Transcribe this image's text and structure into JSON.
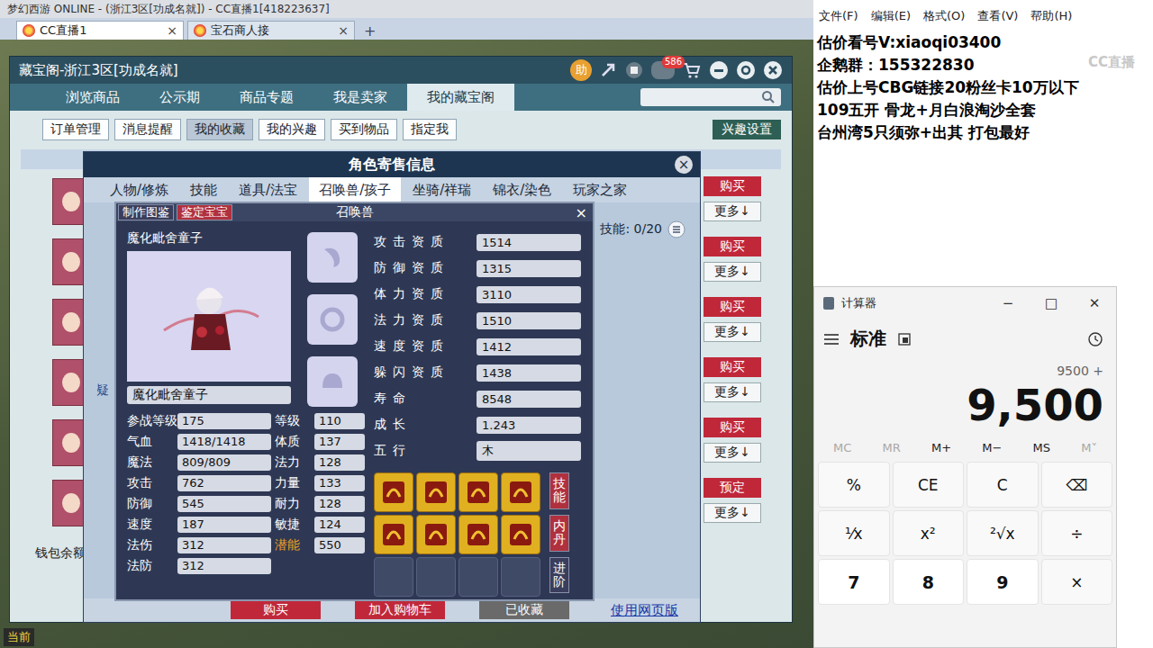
{
  "browser": {
    "title": "梦幻西游 ONLINE - (浙江3区[功成名就]) - CC直播1[418223637]",
    "tabs": [
      {
        "label": "CC直播1",
        "selected": true,
        "close": "×"
      },
      {
        "label": "宝石商人接",
        "selected": false,
        "close": "×"
      }
    ],
    "new_tab": "+"
  },
  "game": {
    "status": "当前"
  },
  "cbg": {
    "title": "藏宝阁-浙江3区[功成名就]",
    "help": "助",
    "badge": "586",
    "nav": [
      {
        "label": "浏览商品",
        "selected": false
      },
      {
        "label": "公示期",
        "selected": false
      },
      {
        "label": "商品专题",
        "selected": false
      },
      {
        "label": "我是卖家",
        "selected": false
      },
      {
        "label": "我的藏宝阁",
        "selected": true
      }
    ],
    "sub_tabs": [
      {
        "label": "订单管理",
        "selected": false
      },
      {
        "label": "消息提醒",
        "selected": false
      },
      {
        "label": "我的收藏",
        "selected": true
      },
      {
        "label": "我的兴趣",
        "selected": false
      },
      {
        "label": "买到物品",
        "selected": false
      },
      {
        "label": "指定我",
        "selected": false
      }
    ],
    "interest": "兴趣设置",
    "rows": [
      {
        "action": "购买",
        "more": "更多↓"
      },
      {
        "action": "购买",
        "more": "更多↓"
      },
      {
        "action": "购买",
        "more": "更多↓"
      },
      {
        "action": "购买",
        "more": "更多↓"
      },
      {
        "action": "购买",
        "more": "更多↓"
      },
      {
        "action": "预定",
        "more": "更多↓"
      }
    ],
    "wallet": "钱包余额"
  },
  "dialog": {
    "title": "角色寄售信息",
    "close": "×",
    "skills_count": "技能: 0/20",
    "hint": "疑",
    "tabs": [
      {
        "label": "人物/修炼",
        "selected": false
      },
      {
        "label": "技能",
        "selected": false
      },
      {
        "label": "道具/法宝",
        "selected": false
      },
      {
        "label": "召唤兽/孩子",
        "selected": true
      },
      {
        "label": "坐骑/祥瑞",
        "selected": false
      },
      {
        "label": "锦衣/染色",
        "selected": false
      },
      {
        "label": "玩家之家",
        "selected": false
      }
    ],
    "footer": [
      "购买",
      "加入购物车",
      "已收藏"
    ],
    "web_link": "使用网页版"
  },
  "pet": {
    "title": "召唤兽",
    "close": "×",
    "buttons": [
      {
        "label": "制作图鉴",
        "color": "#3a3d5c"
      },
      {
        "label": "鉴定宝宝",
        "color": "#b0303e"
      }
    ],
    "name": "魔化毗舍童子",
    "name_field": "魔化毗舍童子",
    "aptitudes": [
      {
        "label": "攻击资质",
        "value": "1514",
        "highlight": false
      },
      {
        "label": "防御资质",
        "value": "1315",
        "highlight": false
      },
      {
        "label": "体力资质",
        "value": "3110",
        "highlight": false
      },
      {
        "label": "法力资质",
        "value": "1510",
        "highlight": false
      },
      {
        "label": "速度资质",
        "value": "1412",
        "highlight": false
      },
      {
        "label": "躲闪资质",
        "value": "1438",
        "highlight": false
      },
      {
        "label": "寿命",
        "value": "8548",
        "highlight": true
      },
      {
        "label": "成长",
        "value": "1.243",
        "highlight": true
      },
      {
        "label": "五行",
        "value": "木",
        "highlight": true
      }
    ],
    "stats": [
      {
        "label": "参战等级",
        "value": "175",
        "highlight": false
      },
      {
        "label": "等级",
        "value": "110",
        "highlight": false
      },
      {
        "label": "气血",
        "value": "1418/1418",
        "highlight": false
      },
      {
        "label": "体质",
        "value": "137",
        "highlight": false
      },
      {
        "label": "魔法",
        "value": "809/809",
        "highlight": false
      },
      {
        "label": "法力",
        "value": "128",
        "highlight": false
      },
      {
        "label": "攻击",
        "value": "762",
        "highlight": false
      },
      {
        "label": "力量",
        "value": "133",
        "highlight": false
      },
      {
        "label": "防御",
        "value": "545",
        "highlight": false
      },
      {
        "label": "耐力",
        "value": "128",
        "highlight": false
      },
      {
        "label": "速度",
        "value": "187",
        "highlight": false
      },
      {
        "label": "敏捷",
        "value": "124",
        "highlight": false
      },
      {
        "label": "法伤",
        "value": "312",
        "highlight": false
      },
      {
        "label": "潜能",
        "value": "550",
        "highlight": true
      },
      {
        "label": "法防",
        "value": "312",
        "highlight": false
      }
    ],
    "skills": [
      {
        "filled": true
      },
      {
        "filled": true
      },
      {
        "filled": true
      },
      {
        "filled": true
      },
      {
        "filled": true
      },
      {
        "filled": true
      },
      {
        "filled": true
      },
      {
        "filled": true
      },
      {
        "filled": false
      },
      {
        "filled": false
      },
      {
        "filled": false
      },
      {
        "filled": false
      }
    ],
    "side_buttons": [
      {
        "label": "技能",
        "color": "#b0303e"
      },
      {
        "label": "内丹",
        "color": "#b0303e"
      },
      {
        "label": "进阶",
        "color": "#3a3d5c"
      }
    ]
  },
  "notepad": {
    "menu": [
      "文件(F)",
      "编辑(E)",
      "格式(O)",
      "查看(V)",
      "帮助(H)"
    ],
    "watermark": "CC直播",
    "lines": [
      "估价看号V:xiaoqi03400",
      "企鹅群：155322830",
      "估价上号CBG链接20粉丝卡10万以下",
      "109五开 骨龙+月白浪淘沙全套",
      "台州湾5只须弥+出其 打包最好"
    ]
  },
  "calculator": {
    "title": "计算器",
    "controls": [
      "−",
      "□",
      "✕"
    ],
    "mode": "标准",
    "history": "9500 +",
    "display": "9,500",
    "memory": [
      {
        "label": "MC",
        "disabled": true
      },
      {
        "label": "MR",
        "disabled": true
      },
      {
        "label": "M+",
        "disabled": false
      },
      {
        "label": "M−",
        "disabled": false
      },
      {
        "label": "MS",
        "disabled": false
      },
      {
        "label": "M˅",
        "disabled": true
      }
    ],
    "keys": [
      {
        "label": "%",
        "kind": "func"
      },
      {
        "label": "CE",
        "kind": "func"
      },
      {
        "label": "C",
        "kind": "func"
      },
      {
        "label": "⌫",
        "kind": "func"
      },
      {
        "label": "¹⁄x",
        "kind": "func"
      },
      {
        "label": "x²",
        "kind": "func"
      },
      {
        "label": "²√x",
        "kind": "func"
      },
      {
        "label": "÷",
        "kind": "func"
      },
      {
        "label": "7",
        "kind": "digit"
      },
      {
        "label": "8",
        "kind": "digit"
      },
      {
        "label": "9",
        "kind": "digit"
      },
      {
        "label": "×",
        "kind": "func"
      }
    ]
  }
}
